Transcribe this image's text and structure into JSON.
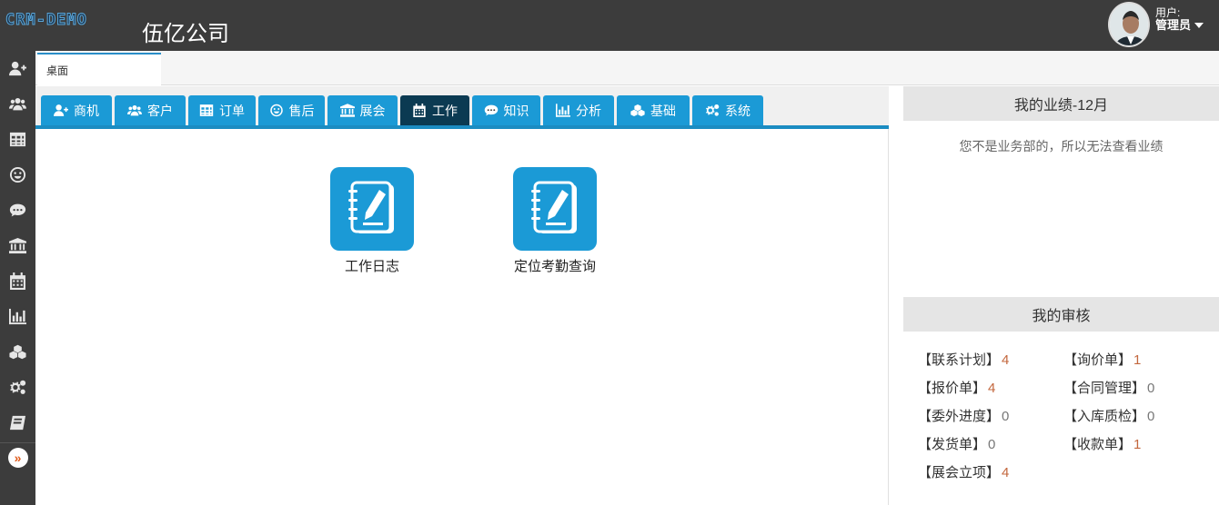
{
  "header": {
    "logo": "CRM-DEMO",
    "company": "伍亿公司",
    "user_label": "用户:",
    "user_name": "管理员"
  },
  "sidebar": {
    "icons": [
      "add-user-icon",
      "users-icon",
      "table-icon",
      "smile-icon",
      "comment-icon",
      "bank-icon",
      "calendar-icon",
      "bar-chart-icon",
      "cubes-icon",
      "gears-icon",
      "book-icon"
    ],
    "toggle": "»"
  },
  "tabstrip": {
    "desk": "桌面"
  },
  "modules": [
    {
      "label": "商机",
      "icon": "add-user-icon"
    },
    {
      "label": "客户",
      "icon": "users-icon"
    },
    {
      "label": "订单",
      "icon": "table-icon"
    },
    {
      "label": "售后",
      "icon": "smile-icon"
    },
    {
      "label": "展会",
      "icon": "bank-icon"
    },
    {
      "label": "工作",
      "icon": "calendar-icon",
      "active": true
    },
    {
      "label": "知识",
      "icon": "comment-icon"
    },
    {
      "label": "分析",
      "icon": "bar-chart-icon"
    },
    {
      "label": "基础",
      "icon": "cubes-icon"
    },
    {
      "label": "系统",
      "icon": "gears-icon"
    }
  ],
  "apps": [
    {
      "label": "工作日志",
      "icon": "notebook-pencil-icon"
    },
    {
      "label": "定位考勤查询",
      "icon": "notebook-pencil-icon"
    }
  ],
  "performance": {
    "title": "我的业绩-12月",
    "note": "您不是业务部的，所以无法查看业绩"
  },
  "review": {
    "title": "我的审核",
    "items": [
      {
        "label": "【联系计划】",
        "count": "4"
      },
      {
        "label": "【询价单】",
        "count": "1"
      },
      {
        "label": "【报价单】",
        "count": "4"
      },
      {
        "label": "【合同管理】",
        "count": "0"
      },
      {
        "label": "【委外进度】",
        "count": "0"
      },
      {
        "label": "【入库质检】",
        "count": "0"
      },
      {
        "label": "【发货单】",
        "count": "0"
      },
      {
        "label": "【收款单】",
        "count": "1"
      },
      {
        "label": "【展会立项】",
        "count": "4"
      }
    ]
  },
  "colors": {
    "accent": "#1b9ad6",
    "active_tab": "#0b3a52",
    "header": "#3c3c3c",
    "count_highlight": "#c3673d"
  }
}
